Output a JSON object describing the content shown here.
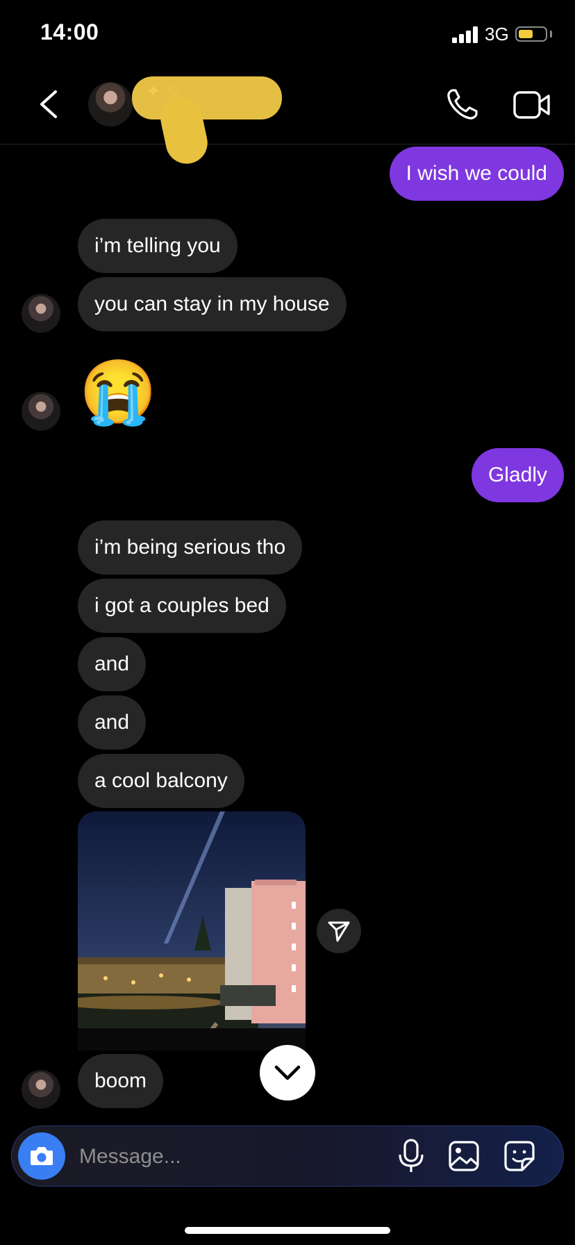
{
  "status_bar": {
    "time": "14:00",
    "network": "3G",
    "battery_level": 0.55
  },
  "header": {
    "contact_name": "S"
  },
  "messages": [
    {
      "from": "me",
      "text": "I wish we could"
    },
    {
      "from": "them",
      "text": "i’m telling you"
    },
    {
      "from": "them",
      "text": "you can stay in my house"
    },
    {
      "from": "them",
      "text": "😭"
    },
    {
      "from": "me",
      "text": "Gladly"
    },
    {
      "from": "them",
      "text": "i’m being serious tho"
    },
    {
      "from": "them",
      "text": "i got a couples bed"
    },
    {
      "from": "them",
      "text": "and"
    },
    {
      "from": "them",
      "text": "and"
    },
    {
      "from": "them",
      "text": "a cool balcony"
    },
    {
      "from": "them",
      "text": "boom"
    }
  ],
  "composer": {
    "placeholder": "Message..."
  },
  "colors": {
    "outgoing_bubble": "#7f37e0",
    "incoming_bubble": "#262626",
    "camera_button": "#3a7ef4"
  },
  "icons": [
    "back-icon",
    "phone-icon",
    "video-icon",
    "send-icon",
    "chevron-down-icon",
    "camera-icon",
    "mic-icon",
    "gallery-icon",
    "sticker-icon"
  ]
}
